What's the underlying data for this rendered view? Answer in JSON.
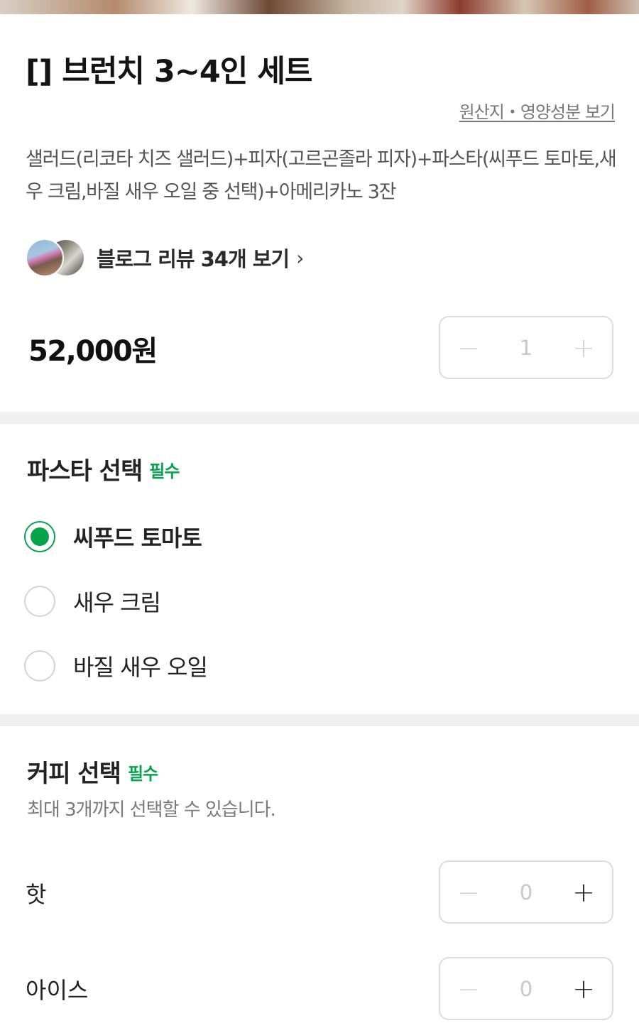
{
  "product": {
    "title": "[] 브런치 3~4인 세트",
    "origin_link": "원산지・영양성분 보기",
    "description": "샐러드(리코타 치즈 샐러드)+피자(고르곤졸라 피자)+파스타(씨푸드 토마토,새우 크림,바질 새우 오일 중 선택)+아메리카노 3잔",
    "review_link": "블로그 리뷰 34개 보기",
    "review_chevron": "›",
    "price": "52,000원",
    "quantity": {
      "minus": "−",
      "value": "1",
      "plus": "+"
    }
  },
  "pasta_section": {
    "title": "파스타 선택",
    "required": "필수",
    "options": [
      {
        "label": "씨푸드 토마토",
        "selected": true
      },
      {
        "label": "새우 크림",
        "selected": false
      },
      {
        "label": "바질 새우 오일",
        "selected": false
      }
    ]
  },
  "coffee_section": {
    "title": "커피 선택",
    "required": "필수",
    "hint": "최대 3개까지 선택할 수 있습니다.",
    "items": [
      {
        "label": "핫",
        "minus": "−",
        "value": "0",
        "plus": "+"
      },
      {
        "label": "아이스",
        "minus": "−",
        "value": "0",
        "plus": "+"
      }
    ]
  },
  "colors": {
    "accent": "#07a34c",
    "divider": "#f0f0f0",
    "border": "#dcdcdc"
  }
}
